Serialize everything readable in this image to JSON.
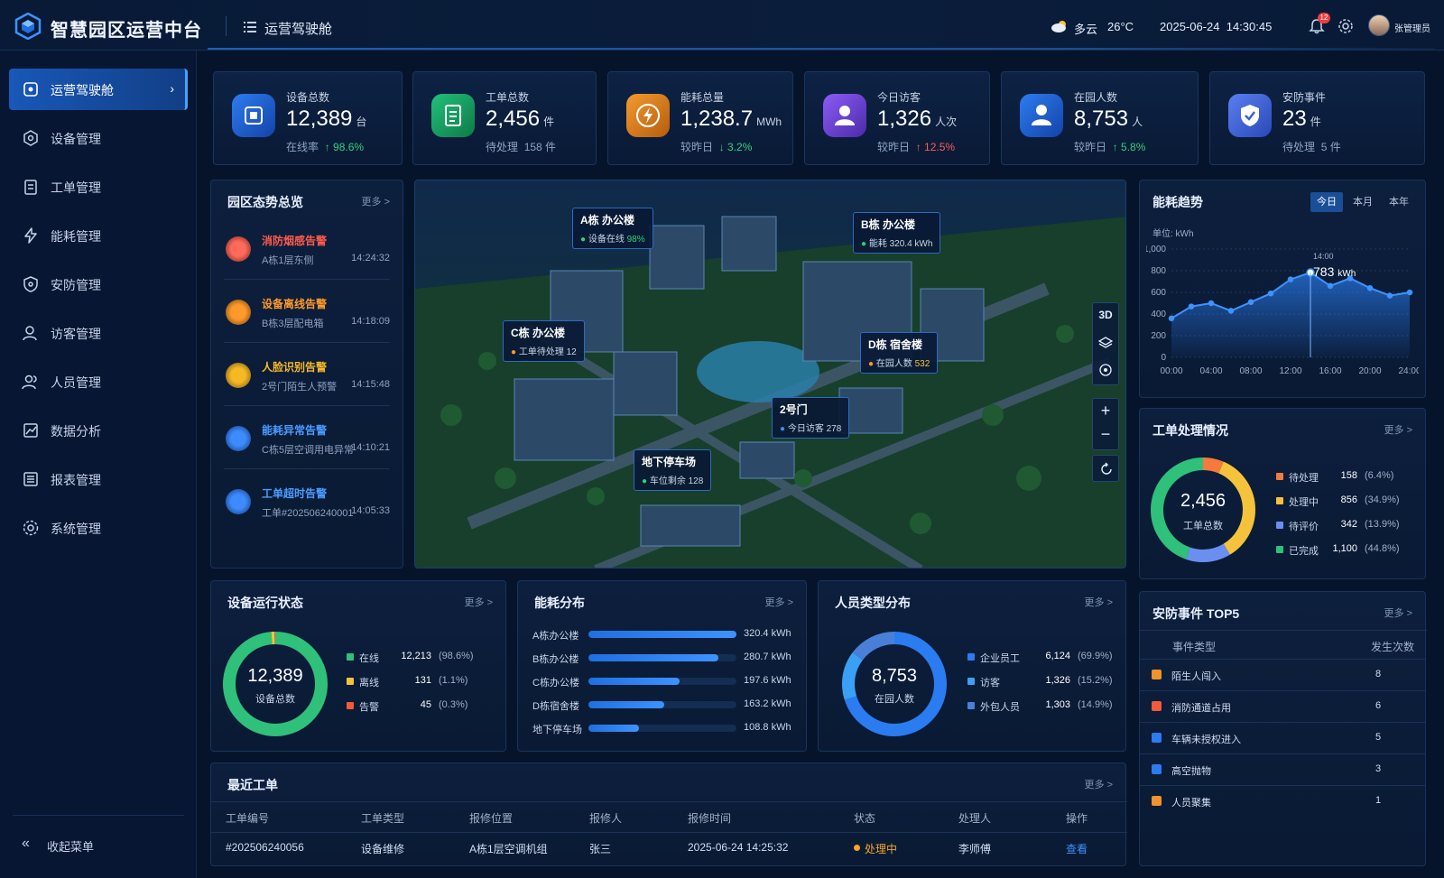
{
  "header": {
    "app_title": "智慧园区运营中台",
    "page_title": "运营驾驶舱",
    "weather": "多云",
    "temperature": "26°C",
    "datetime": "2025-06-24  14:30:45",
    "notification_count": "12",
    "user_name": "张管理员"
  },
  "sidebar": {
    "items": [
      {
        "label": "运营驾驶舱",
        "icon": "dashboard-icon"
      },
      {
        "label": "设备管理",
        "icon": "device-icon"
      },
      {
        "label": "工单管理",
        "icon": "clipboard-icon"
      },
      {
        "label": "能耗管理",
        "icon": "bolt-icon"
      },
      {
        "label": "安防管理",
        "icon": "shield-icon"
      },
      {
        "label": "访客管理",
        "icon": "visitor-icon"
      },
      {
        "label": "人员管理",
        "icon": "people-icon"
      },
      {
        "label": "数据分析",
        "icon": "chart-icon"
      },
      {
        "label": "报表管理",
        "icon": "report-icon"
      },
      {
        "label": "系统管理",
        "icon": "gear-icon"
      }
    ],
    "collapse_label": "收起菜单"
  },
  "kpis": [
    {
      "label": "设备总数",
      "value": "12,389",
      "unit": "台",
      "sub_prefix": "在线率",
      "sub_value": "↑ 98.6%",
      "color": "#1f6fe0"
    },
    {
      "label": "工单总数",
      "value": "2,456",
      "unit": "件",
      "sub_prefix": "待处理",
      "sub_value": "158 件",
      "color": "#18a860"
    },
    {
      "label": "能耗总量",
      "value": "1,238.7",
      "unit": "MWh",
      "sub_prefix": "较昨日",
      "sub_value": "↓ 3.2%",
      "color": "#e07b1a"
    },
    {
      "label": "今日访客",
      "value": "1,326",
      "unit": "人次",
      "sub_prefix": "较昨日",
      "sub_value": "↑ 12.5%",
      "color": "#7a4fe0"
    },
    {
      "label": "在园人数",
      "value": "8,753",
      "unit": "人",
      "sub_prefix": "较昨日",
      "sub_value": "↑ 5.8%",
      "color": "#1f6fe0"
    },
    {
      "label": "安防事件",
      "value": "23",
      "unit": "件",
      "sub_prefix": "待处理",
      "sub_value": "5 件",
      "color": "#3d6fe0"
    }
  ],
  "alerts": {
    "title": "园区态势总览",
    "more": "更多 >",
    "items": [
      {
        "title": "消防烟感告警",
        "desc": "A栋1层东侧",
        "time": "14:24:32",
        "color": "#ff5b4a"
      },
      {
        "title": "设备离线告警",
        "desc": "B栋3层配电箱",
        "time": "14:18:09",
        "color": "#ff9a2a"
      },
      {
        "title": "人脸识别告警",
        "desc": "2号门陌生人预警",
        "time": "14:15:48",
        "color": "#f5b925"
      },
      {
        "title": "能耗异常告警",
        "desc": "C栋5层空调用电异常",
        "time": "14:10:21",
        "color": "#3d8bff"
      },
      {
        "title": "工单超时告警",
        "desc": "工单#202506240001",
        "time": "14:05:33",
        "color": "#3d8bff"
      }
    ]
  },
  "map": {
    "tags": [
      {
        "title": "A栋 办公楼",
        "sub_label": "设备在线",
        "sub_value": "98%"
      },
      {
        "title": "B栋 办公楼",
        "sub_label": "能耗",
        "sub_value": "320.4 kWh"
      },
      {
        "title": "C栋 办公楼",
        "sub_label": "工单待处理",
        "sub_value": "12"
      },
      {
        "title": "D栋 宿舍楼",
        "sub_label": "在园人数",
        "sub_value": "532"
      },
      {
        "title": "2号门",
        "sub_label": "今日访客",
        "sub_value": "278"
      },
      {
        "title": "地下停车场",
        "sub_label": "车位剩余",
        "sub_value": "128"
      }
    ],
    "controls": {
      "mode": "3D"
    }
  },
  "energy_trend": {
    "title": "能耗趋势",
    "tabs": [
      "今日",
      "本月",
      "本年"
    ],
    "unit_label": "单位: kWh",
    "tooltip_time": "14:00",
    "tooltip_value": "783",
    "tooltip_unit": "kWh"
  },
  "chart_data": [
    {
      "type": "area",
      "title": "能耗趋势",
      "ylabel": "单位: kWh",
      "ylim": [
        0,
        1000
      ],
      "y_ticks": [
        "0",
        "200",
        "400",
        "600",
        "800",
        "1,000"
      ],
      "x_ticks": [
        "00:00",
        "04:00",
        "08:00",
        "12:00",
        "16:00",
        "20:00",
        "24:00"
      ],
      "x": [
        0,
        2,
        4,
        6,
        8,
        10,
        12,
        14,
        16,
        18,
        20,
        22,
        24
      ],
      "values": [
        360,
        470,
        500,
        430,
        510,
        590,
        720,
        783,
        660,
        730,
        640,
        570,
        600
      ]
    },
    {
      "type": "pie",
      "title": "工单处理情况",
      "center_value": "2,456",
      "center_label": "工单总数",
      "slices": [
        {
          "name": "待处理",
          "value": 158,
          "pct": "(6.4%)",
          "color": "#f47b3b"
        },
        {
          "name": "处理中",
          "value": 856,
          "pct": "(34.9%)",
          "color": "#f5c33b"
        },
        {
          "name": "待评价",
          "value": 342,
          "pct": "(13.9%)",
          "color": "#6b8ff0"
        },
        {
          "name": "已完成",
          "value": 1100,
          "pct": "(44.8%)",
          "color": "#2fc07a"
        }
      ],
      "value_labels": [
        "158",
        "856",
        "342",
        "1,100"
      ]
    },
    {
      "type": "pie",
      "title": "设备运行状态",
      "center_value": "12,389",
      "center_label": "设备总数",
      "slices": [
        {
          "name": "在线",
          "value": 12213,
          "pct": "(98.6%)",
          "color": "#2fc07a"
        },
        {
          "name": "离线",
          "value": 131,
          "pct": "(1.1%)",
          "color": "#f5c33b"
        },
        {
          "name": "告警",
          "value": 45,
          "pct": "(0.3%)",
          "color": "#f25a3a"
        }
      ],
      "value_labels": [
        "12,213",
        "131",
        "45"
      ]
    },
    {
      "type": "bar",
      "title": "能耗分布",
      "categories": [
        "A栋办公楼",
        "B栋办公楼",
        "C栋办公楼",
        "D栋宿舍楼",
        "地下停车场"
      ],
      "values": [
        320.4,
        280.7,
        197.6,
        163.2,
        108.8
      ],
      "value_labels": [
        "320.4 kWh",
        "280.7 kWh",
        "197.6 kWh",
        "163.2 kWh",
        "108.8 kWh"
      ],
      "xlim": [
        0,
        320.4
      ]
    },
    {
      "type": "pie",
      "title": "人员类型分布",
      "center_value": "8,753",
      "center_label": "在园人数",
      "slices": [
        {
          "name": "企业员工",
          "value": 6124,
          "pct": "(69.9%)",
          "color": "#2a7cf0"
        },
        {
          "name": "访客",
          "value": 1326,
          "pct": "(15.2%)",
          "color": "#3aa0f5"
        },
        {
          "name": "外包人员",
          "value": 1303,
          "pct": "(14.9%)",
          "color": "#4a7fd8"
        }
      ],
      "value_labels": [
        "6,124",
        "1,326",
        "1,303"
      ]
    }
  ],
  "panels": {
    "workorder_title": "工单处理情况",
    "device_title": "设备运行状态",
    "energy_dist_title": "能耗分布",
    "people_title": "人员类型分布",
    "security_title": "安防事件 TOP5",
    "recent_title": "最近工单",
    "more": "更多 >"
  },
  "security_top5": {
    "headers": [
      "事件类型",
      "发生次数"
    ],
    "rows": [
      {
        "name": "陌生人闯入",
        "count": "8",
        "color": "#f0932b"
      },
      {
        "name": "消防通道占用",
        "count": "6",
        "color": "#f25a3a"
      },
      {
        "name": "车辆未授权进入",
        "count": "5",
        "color": "#2a7cf0"
      },
      {
        "name": "高空抛物",
        "count": "3",
        "color": "#2a7cf0"
      },
      {
        "name": "人员聚集",
        "count": "1",
        "color": "#f0932b"
      }
    ]
  },
  "recent_orders": {
    "headers": [
      "工单编号",
      "工单类型",
      "报修位置",
      "报修人",
      "报修时间",
      "状态",
      "处理人",
      "操作"
    ],
    "rows": [
      {
        "id": "#202506240056",
        "type": "设备维修",
        "location": "A栋1层空调机组",
        "reporter": "张三",
        "time": "2025-06-24 14:25:32",
        "status": "处理中",
        "handler": "李师傅",
        "action": "查看"
      }
    ]
  }
}
